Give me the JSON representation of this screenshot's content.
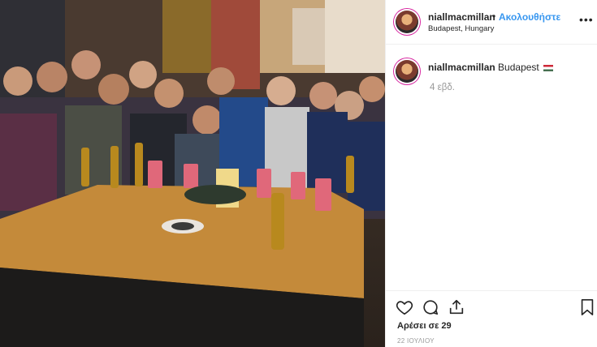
{
  "post": {
    "username": "niallmacmillan",
    "follow_label": "Ακολουθήστε",
    "separator": "•",
    "location": "Budapest, Hungary",
    "more_label": "•••",
    "caption_username": "niallmacmillan",
    "caption_text": "Budapest",
    "caption_flag": "hungary-flag",
    "age": "4 εβδ.",
    "likes": "Αρέσει σε 29",
    "date": "22 ΙΟΥΛΙΟΥ"
  },
  "colors": {
    "accent": "#3897f0",
    "muted": "#999999",
    "text": "#262626"
  },
  "icons": {
    "like": "heart-icon",
    "comment": "comment-icon",
    "share": "share-icon",
    "save": "bookmark-icon",
    "options": "more-options-icon"
  }
}
